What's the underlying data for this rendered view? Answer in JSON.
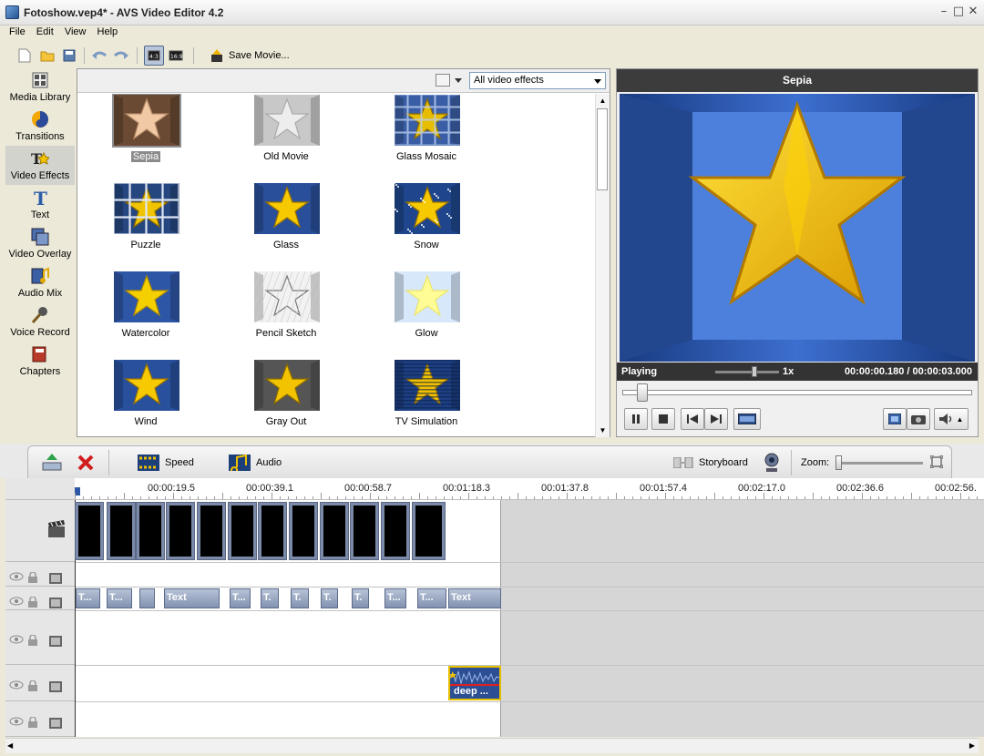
{
  "window": {
    "title": "Fotoshow.vep4* - AVS Video Editor 4.2"
  },
  "menu": [
    "File",
    "Edit",
    "View",
    "Help"
  ],
  "toolbar": {
    "save_movie": "Save Movie..."
  },
  "sidebar": [
    {
      "label": "Media Library",
      "icon": "media-library-icon"
    },
    {
      "label": "Transitions",
      "icon": "transitions-icon"
    },
    {
      "label": "Video Effects",
      "icon": "video-effects-icon",
      "selected": true
    },
    {
      "label": "Text",
      "icon": "text-icon"
    },
    {
      "label": "Video Overlay",
      "icon": "video-overlay-icon"
    },
    {
      "label": "Audio Mix",
      "icon": "audio-mix-icon"
    },
    {
      "label": "Voice Record",
      "icon": "voice-record-icon"
    },
    {
      "label": "Chapters",
      "icon": "chapters-icon"
    }
  ],
  "effects": {
    "filter": "All video effects",
    "items": [
      {
        "label": "Sepia",
        "style": "sepia",
        "selected": true
      },
      {
        "label": "Old Movie",
        "style": "oldmovie"
      },
      {
        "label": "Glass Mosaic",
        "style": "mosaic"
      },
      {
        "label": "Puzzle",
        "style": "puzzle"
      },
      {
        "label": "Glass",
        "style": "glass"
      },
      {
        "label": "Snow",
        "style": "snow"
      },
      {
        "label": "Watercolor",
        "style": "watercolor"
      },
      {
        "label": "Pencil Sketch",
        "style": "pencil"
      },
      {
        "label": "Glow",
        "style": "glow"
      },
      {
        "label": "Wind",
        "style": "wind"
      },
      {
        "label": "Gray Out",
        "style": "grayout"
      },
      {
        "label": "TV Simulation",
        "style": "tv"
      }
    ]
  },
  "preview": {
    "title": "Sepia",
    "status": "Playing",
    "speed": "1x",
    "time": "00:00:00.180 / 00:00:03.000"
  },
  "timeline_toolbar": {
    "speed": "Speed",
    "audio": "Audio",
    "storyboard": "Storyboard",
    "zoom": "Zoom:"
  },
  "ruler": [
    "00:00:19.5",
    "00:00:39.1",
    "00:00:58.7",
    "00:01:18.3",
    "00:01:37.8",
    "00:01:57.4",
    "00:02:17.0",
    "00:02:36.6",
    "00:02:56."
  ],
  "text_clips": [
    "T...",
    "T...",
    "",
    "Text",
    "T...",
    "T.",
    "T.",
    "T.",
    "T.",
    "T...",
    "T...",
    "Text"
  ],
  "audio_clip": "deep ..."
}
